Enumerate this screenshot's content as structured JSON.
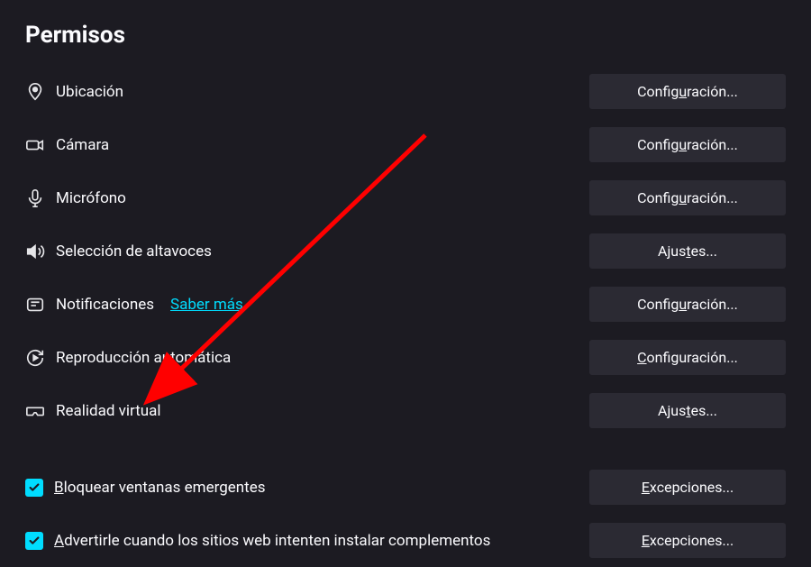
{
  "section_title": "Permisos",
  "rows": [
    {
      "label": "Ubicación",
      "button_pre": "Config",
      "button_u": "u",
      "button_post": "ración..."
    },
    {
      "label": "Cámara",
      "button_pre": "Config",
      "button_u": "u",
      "button_post": "ración..."
    },
    {
      "label": "Micrófono",
      "button_pre": "Config",
      "button_u": "u",
      "button_post": "ración..."
    },
    {
      "label": "Selección de altavoces",
      "button_pre": "Ajus",
      "button_u": "t",
      "button_post": "es..."
    },
    {
      "label": "Notificaciones",
      "link": "Saber más",
      "button_pre": "Config",
      "button_u": "u",
      "button_post": "ración..."
    },
    {
      "label": "Reproducción automática",
      "button_pre": "",
      "button_u": "C",
      "button_post": "onfiguración..."
    },
    {
      "label": "Realidad virtual",
      "button_pre": "Ajus",
      "button_u": "t",
      "button_post": "es..."
    }
  ],
  "checkbox_rows": [
    {
      "label_pre": "",
      "label_u": "B",
      "label_post": "loquear ventanas emergentes",
      "button_pre": "",
      "button_u": "E",
      "button_post": "xcepciones..."
    },
    {
      "label_pre": "",
      "label_u": "A",
      "label_post": "dvertirle cuando los sitios web intenten instalar complementos",
      "button_pre": "",
      "button_u": "E",
      "button_post": "xcepciones..."
    }
  ]
}
